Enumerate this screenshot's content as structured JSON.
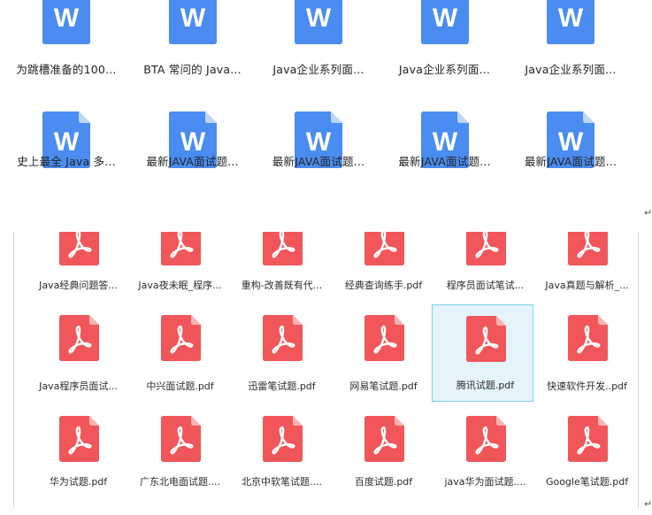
{
  "word_files": [
    {
      "label": "为跳槽准备的100..."
    },
    {
      "label": "BTA 常问的 Java..."
    },
    {
      "label": "Java企业系列面..."
    },
    {
      "label": "Java企业系列面..."
    },
    {
      "label": "Java企业系列面..."
    },
    {
      "label": "史上最全 Java 多..."
    },
    {
      "label": "最新JAVA面试题..."
    },
    {
      "label": "最新JAVA面试题..."
    },
    {
      "label": "最新JAVA面试题..."
    },
    {
      "label": "最新JAVA面试题..."
    }
  ],
  "word_icon_letter": "W",
  "pdf_files": [
    {
      "label": "Java经典问题答..."
    },
    {
      "label": "Java夜未眠_程序..."
    },
    {
      "label": "重构-改善既有代..."
    },
    {
      "label": "经典查询练手.pdf"
    },
    {
      "label": "程序员面试笔试..."
    },
    {
      "label": "Java真题与解析_..."
    },
    {
      "label": "Java程序员面试..."
    },
    {
      "label": "中兴面试题.pdf"
    },
    {
      "label": "迅雷笔试题.pdf"
    },
    {
      "label": "网易笔试题.pdf"
    },
    {
      "label": "腾讯试题.pdf"
    },
    {
      "label": "快速软件开发..pdf"
    },
    {
      "label": "华为试题.pdf"
    },
    {
      "label": "广东北电面试题...."
    },
    {
      "label": "北京中软笔试题...."
    },
    {
      "label": "百度试题.pdf"
    },
    {
      "label": "java华为面试题...."
    },
    {
      "label": "Google笔试题.pdf"
    }
  ],
  "selected_pdf_index": 10,
  "paragraph_mark": "↵",
  "colors": {
    "word_icon": "#4a8cf0",
    "word_fold": "#bcd6fb",
    "pdf_icon": "#f0565a",
    "pdf_fold": "#f9b3b4",
    "selection_bg": "#e5f3fb",
    "selection_border": "#7ad0ec"
  }
}
